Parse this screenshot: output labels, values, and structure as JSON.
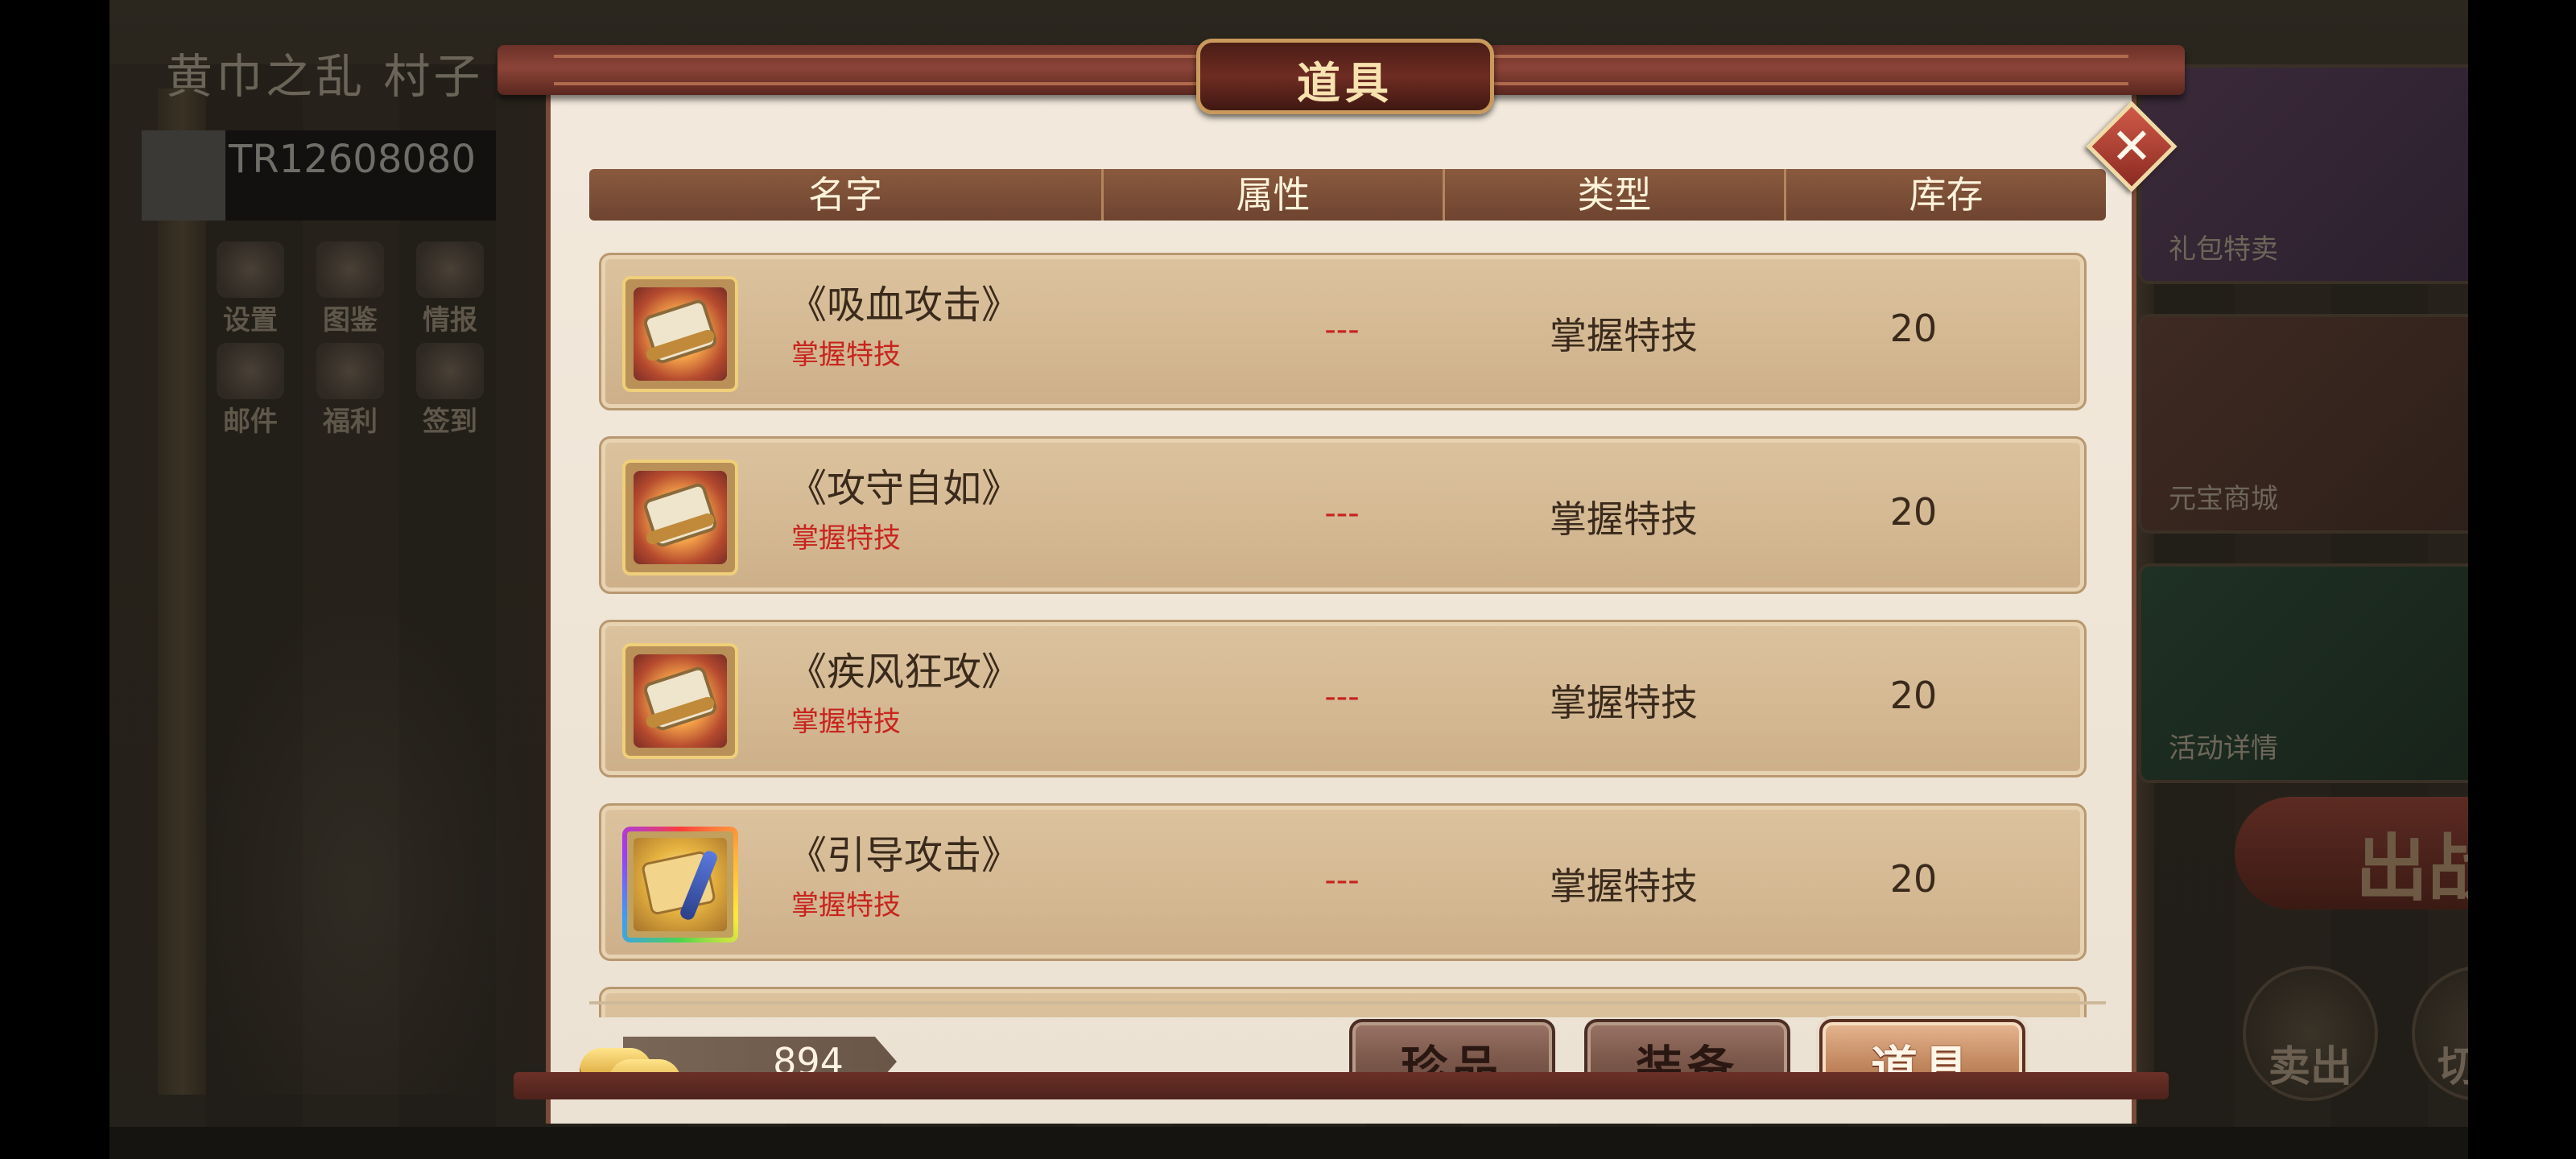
{
  "background": {
    "scene_title": "黄巾之乱 村子",
    "player_id": "TR12608080",
    "menu": [
      "设置",
      "图鉴",
      "情报",
      "邮件",
      "福利",
      "签到"
    ],
    "cards": [
      "礼包特卖",
      "元宝商城",
      "活动详情"
    ],
    "battle_label": "出战",
    "round_buttons": [
      "卖出",
      "切换"
    ]
  },
  "dialog": {
    "title": "道具",
    "close_symbol": "✕",
    "columns": [
      "名字",
      "属性",
      "类型",
      "库存"
    ],
    "items": [
      {
        "name": "《吸血攻击》",
        "subtitle": "掌握特技",
        "attribute": "---",
        "type": "掌握特技",
        "stock": "20",
        "icon": "skill-scroll-icon"
      },
      {
        "name": "《攻守自如》",
        "subtitle": "掌握特技",
        "attribute": "---",
        "type": "掌握特技",
        "stock": "20",
        "icon": "skill-scroll-icon"
      },
      {
        "name": "《疾风狂攻》",
        "subtitle": "掌握特技",
        "attribute": "---",
        "type": "掌握特技",
        "stock": "20",
        "icon": "skill-scroll-icon"
      },
      {
        "name": "《引导攻击》",
        "subtitle": "掌握特技",
        "attribute": "---",
        "type": "掌握特技",
        "stock": "20",
        "icon": "guide-scroll-icon"
      }
    ],
    "currency": {
      "icon": "gold-ingot-icon",
      "value": "894"
    },
    "tabs": [
      {
        "label": "珍品",
        "active": false
      },
      {
        "label": "装备",
        "active": false
      },
      {
        "label": "道具",
        "active": true
      }
    ]
  },
  "colors": {
    "accent_red": "#c8241e",
    "frame_brown": "#6b3128",
    "header_brown": "#7a4e38",
    "active_tab": "#c48a62"
  }
}
